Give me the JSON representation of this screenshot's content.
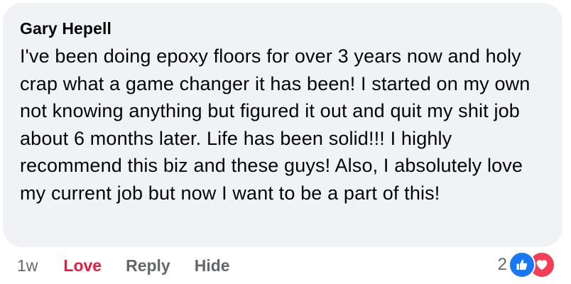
{
  "comment": {
    "author": "Gary Hepell",
    "text": "I've been doing epoxy floors for over 3 years now and holy crap what a game changer it has been! I started on my own not knowing anything but figured it out and quit my shit job about 6 months later. Life has been solid!!! I highly recommend this biz and these guys! Also, I absolutely love my current job but now I want to be a part of this!"
  },
  "actions": {
    "timestamp": "1w",
    "love_label": "Love",
    "reply_label": "Reply",
    "hide_label": "Hide"
  },
  "reactions": {
    "count": "2",
    "icons": [
      "like-icon",
      "heart-icon"
    ],
    "like_color": "#1877f2",
    "heart_color": "#f33e58",
    "love_active_color": "#e41e3f"
  }
}
